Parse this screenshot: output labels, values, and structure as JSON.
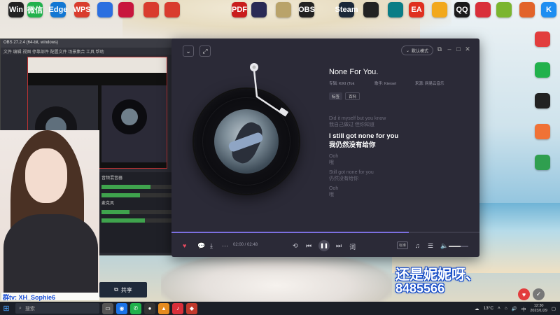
{
  "desktop": {
    "icons_top": [
      {
        "label": "Win",
        "color": "#222"
      },
      {
        "label": "微信",
        "color": "#21b14c"
      },
      {
        "label": "Edge",
        "color": "#1277d3"
      },
      {
        "label": "WPS",
        "color": "#d93c2e"
      },
      {
        "label": "",
        "color": "#2b6fe0"
      },
      {
        "label": "",
        "color": "#c8163d"
      },
      {
        "label": "",
        "color": "#d93c2e"
      },
      {
        "label": "",
        "color": "#d93c2e"
      },
      {
        "label": "PDF",
        "color": "#c91d1d"
      },
      {
        "label": "",
        "color": "#2a2a55"
      },
      {
        "label": "",
        "color": "#b9a36a"
      },
      {
        "label": "OBS",
        "color": "#222"
      },
      {
        "label": "Steam",
        "color": "#1b2838"
      },
      {
        "label": "",
        "color": "#222"
      },
      {
        "label": "",
        "color": "#0a7d86"
      },
      {
        "label": "EA",
        "color": "#e0301e"
      },
      {
        "label": "",
        "color": "#f2a81b"
      },
      {
        "label": "QQ",
        "color": "#1a1a1a"
      },
      {
        "label": "",
        "color": "#d92f3a"
      },
      {
        "label": "",
        "color": "#7bb52f"
      },
      {
        "label": "",
        "color": "#e2632a"
      },
      {
        "label": "K",
        "color": "#1e8ef1"
      }
    ],
    "icons_right": [
      {
        "label": "",
        "color": "#e23d3d"
      },
      {
        "label": "",
        "color": "#21b14c"
      },
      {
        "label": "",
        "color": "#222"
      },
      {
        "label": "",
        "color": "#f07236"
      },
      {
        "label": "",
        "color": "#2f9f4f"
      }
    ],
    "overlay_name": "还是妮妮呀、",
    "overlay_number": "8485566",
    "cam_name": "群tv: XH_Sophie6",
    "share_label": "共享"
  },
  "player": {
    "mode_label": "默认模式",
    "song_title": "None For You.",
    "album_label": "专辑: KIKI (Tok",
    "singer_label": "歌手: Kiersel",
    "source_label": "来源: 网易云音乐",
    "tags": [
      "标签",
      "百科"
    ],
    "lyrics": [
      {
        "text": "Did it myself but you know",
        "current": false
      },
      {
        "text": "我自己做过 但你知道",
        "current": false
      },
      {
        "text": "I still got none for you",
        "current": true
      },
      {
        "text": "我仍然没有给你",
        "current": true
      },
      {
        "text": "Ooh",
        "current": false
      },
      {
        "text": "哦",
        "current": false
      },
      {
        "text": "Still got none for you",
        "current": false
      },
      {
        "text": "仍然没有给你",
        "current": false
      },
      {
        "text": "Ooh",
        "current": false
      },
      {
        "text": "哦",
        "current": false
      }
    ],
    "time": "02:00 / 02:48",
    "progress": 0.77,
    "volume": 0.6,
    "quality_label": "标准",
    "accent": "#7c6fe0"
  },
  "taskbar": {
    "search_placeholder": "搜索",
    "temperature": "13°C",
    "time": "12:30",
    "date": "2023/1/29"
  }
}
